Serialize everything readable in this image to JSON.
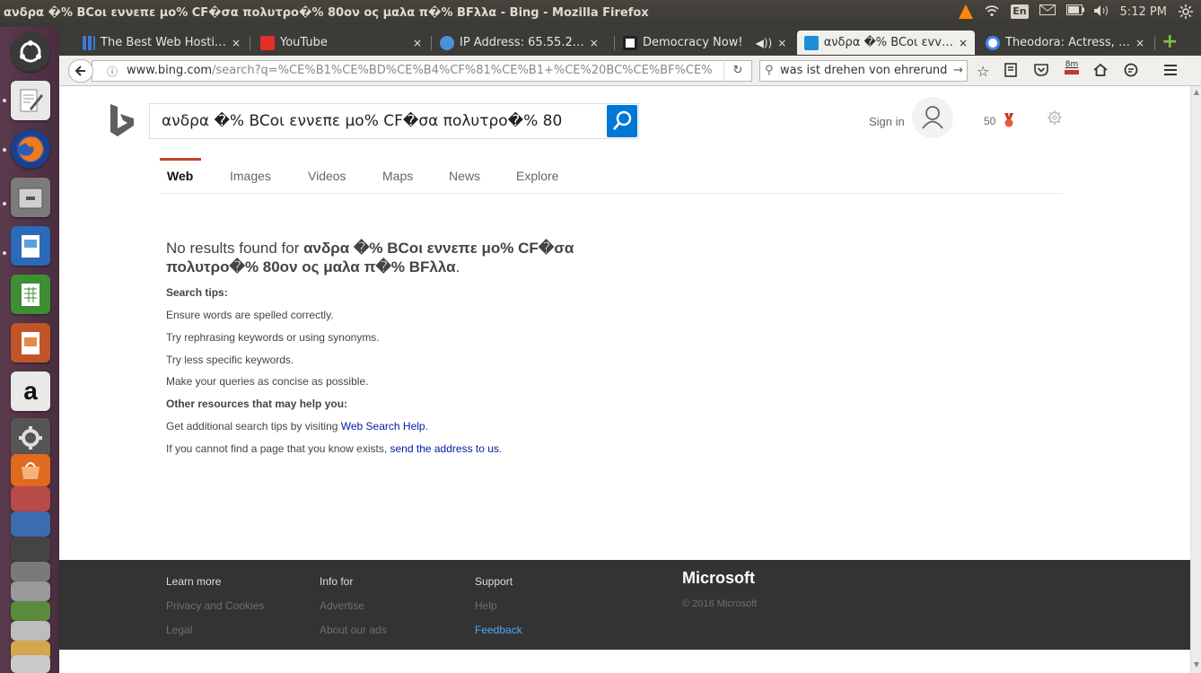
{
  "system": {
    "window_title": "ανδρα �% BCoι εννεπε μο% CF�σα πολυτρο�% 80ον ος μαλα π�% BFλλα - Bing - Mozilla Firefox",
    "keyboard_layout": "En",
    "clock": "5:12 PM"
  },
  "tabs": [
    {
      "label": "The Best Web Hosti…",
      "icon": "grid-icon",
      "active": false
    },
    {
      "label": "YouTube",
      "icon": "youtube-icon",
      "active": false
    },
    {
      "label": "IP Address: 65.55.2…",
      "icon": "globe-icon",
      "active": false
    },
    {
      "label": "Democracy Now!",
      "icon": "dn-icon",
      "active": false
    },
    {
      "label": "ανδρα �% BCoι εvv…",
      "icon": "bing-icon",
      "active": true
    },
    {
      "label": "Theodora: Actress, …",
      "icon": "google-icon",
      "active": false
    }
  ],
  "tab_close": "×",
  "tab_add": "+",
  "navbar": {
    "url_domain": "www.bing.com",
    "url_path": "/search?q=%CE%B1%CE%BD%CE%B4%CF%81%CE%B1+%CE%20BC%CE%BF%CE%",
    "search_value": "was ist drehen von ehrerund",
    "pocket_badge": "8m"
  },
  "bing": {
    "search_query": "ανδρα �% BCoι εννεπε μο% CF�σα πολυτρο�% 80",
    "sign_in": "Sign in",
    "rewards_count": "50",
    "scopes": [
      "Web",
      "Images",
      "Videos",
      "Maps",
      "News",
      "Explore"
    ],
    "no_results_prefix": "No results found for ",
    "no_results_query": "ανδρα �% BCoι εννεπε μο% CF�σα πολυτρο�% 80ον ος μαλα π�% BFλλα",
    "no_results_suffix": ".",
    "search_tips_heading": "Search tips:",
    "tips": [
      "Ensure words are spelled correctly.",
      "Try rephrasing keywords or using synonyms.",
      "Try less specific keywords.",
      "Make your queries as concise as possible."
    ],
    "other_resources_heading": "Other resources that may help you:",
    "help_text": "Get additional search tips by visiting ",
    "help_link": "Web Search Help",
    "help_end": ".",
    "address_text": "If you cannot find a page that you know exists, ",
    "address_link": "send the address to us",
    "address_end": "."
  },
  "footer": {
    "col1": {
      "head": "Learn more",
      "links": [
        "Privacy and Cookies",
        "Legal"
      ]
    },
    "col2": {
      "head": "Info for",
      "links": [
        "Advertise",
        "About our ads"
      ]
    },
    "col3": {
      "head": "Support",
      "links": [
        "Help",
        "Feedback"
      ]
    },
    "brand": "Microsoft",
    "copyright": "© 2016 Microsoft"
  },
  "colors": {
    "bing_blue": "#0078d7",
    "active_scope_underline": "#c2452d",
    "link_blue": "#001ba0",
    "launcher_bg": "#5b3a4e"
  }
}
